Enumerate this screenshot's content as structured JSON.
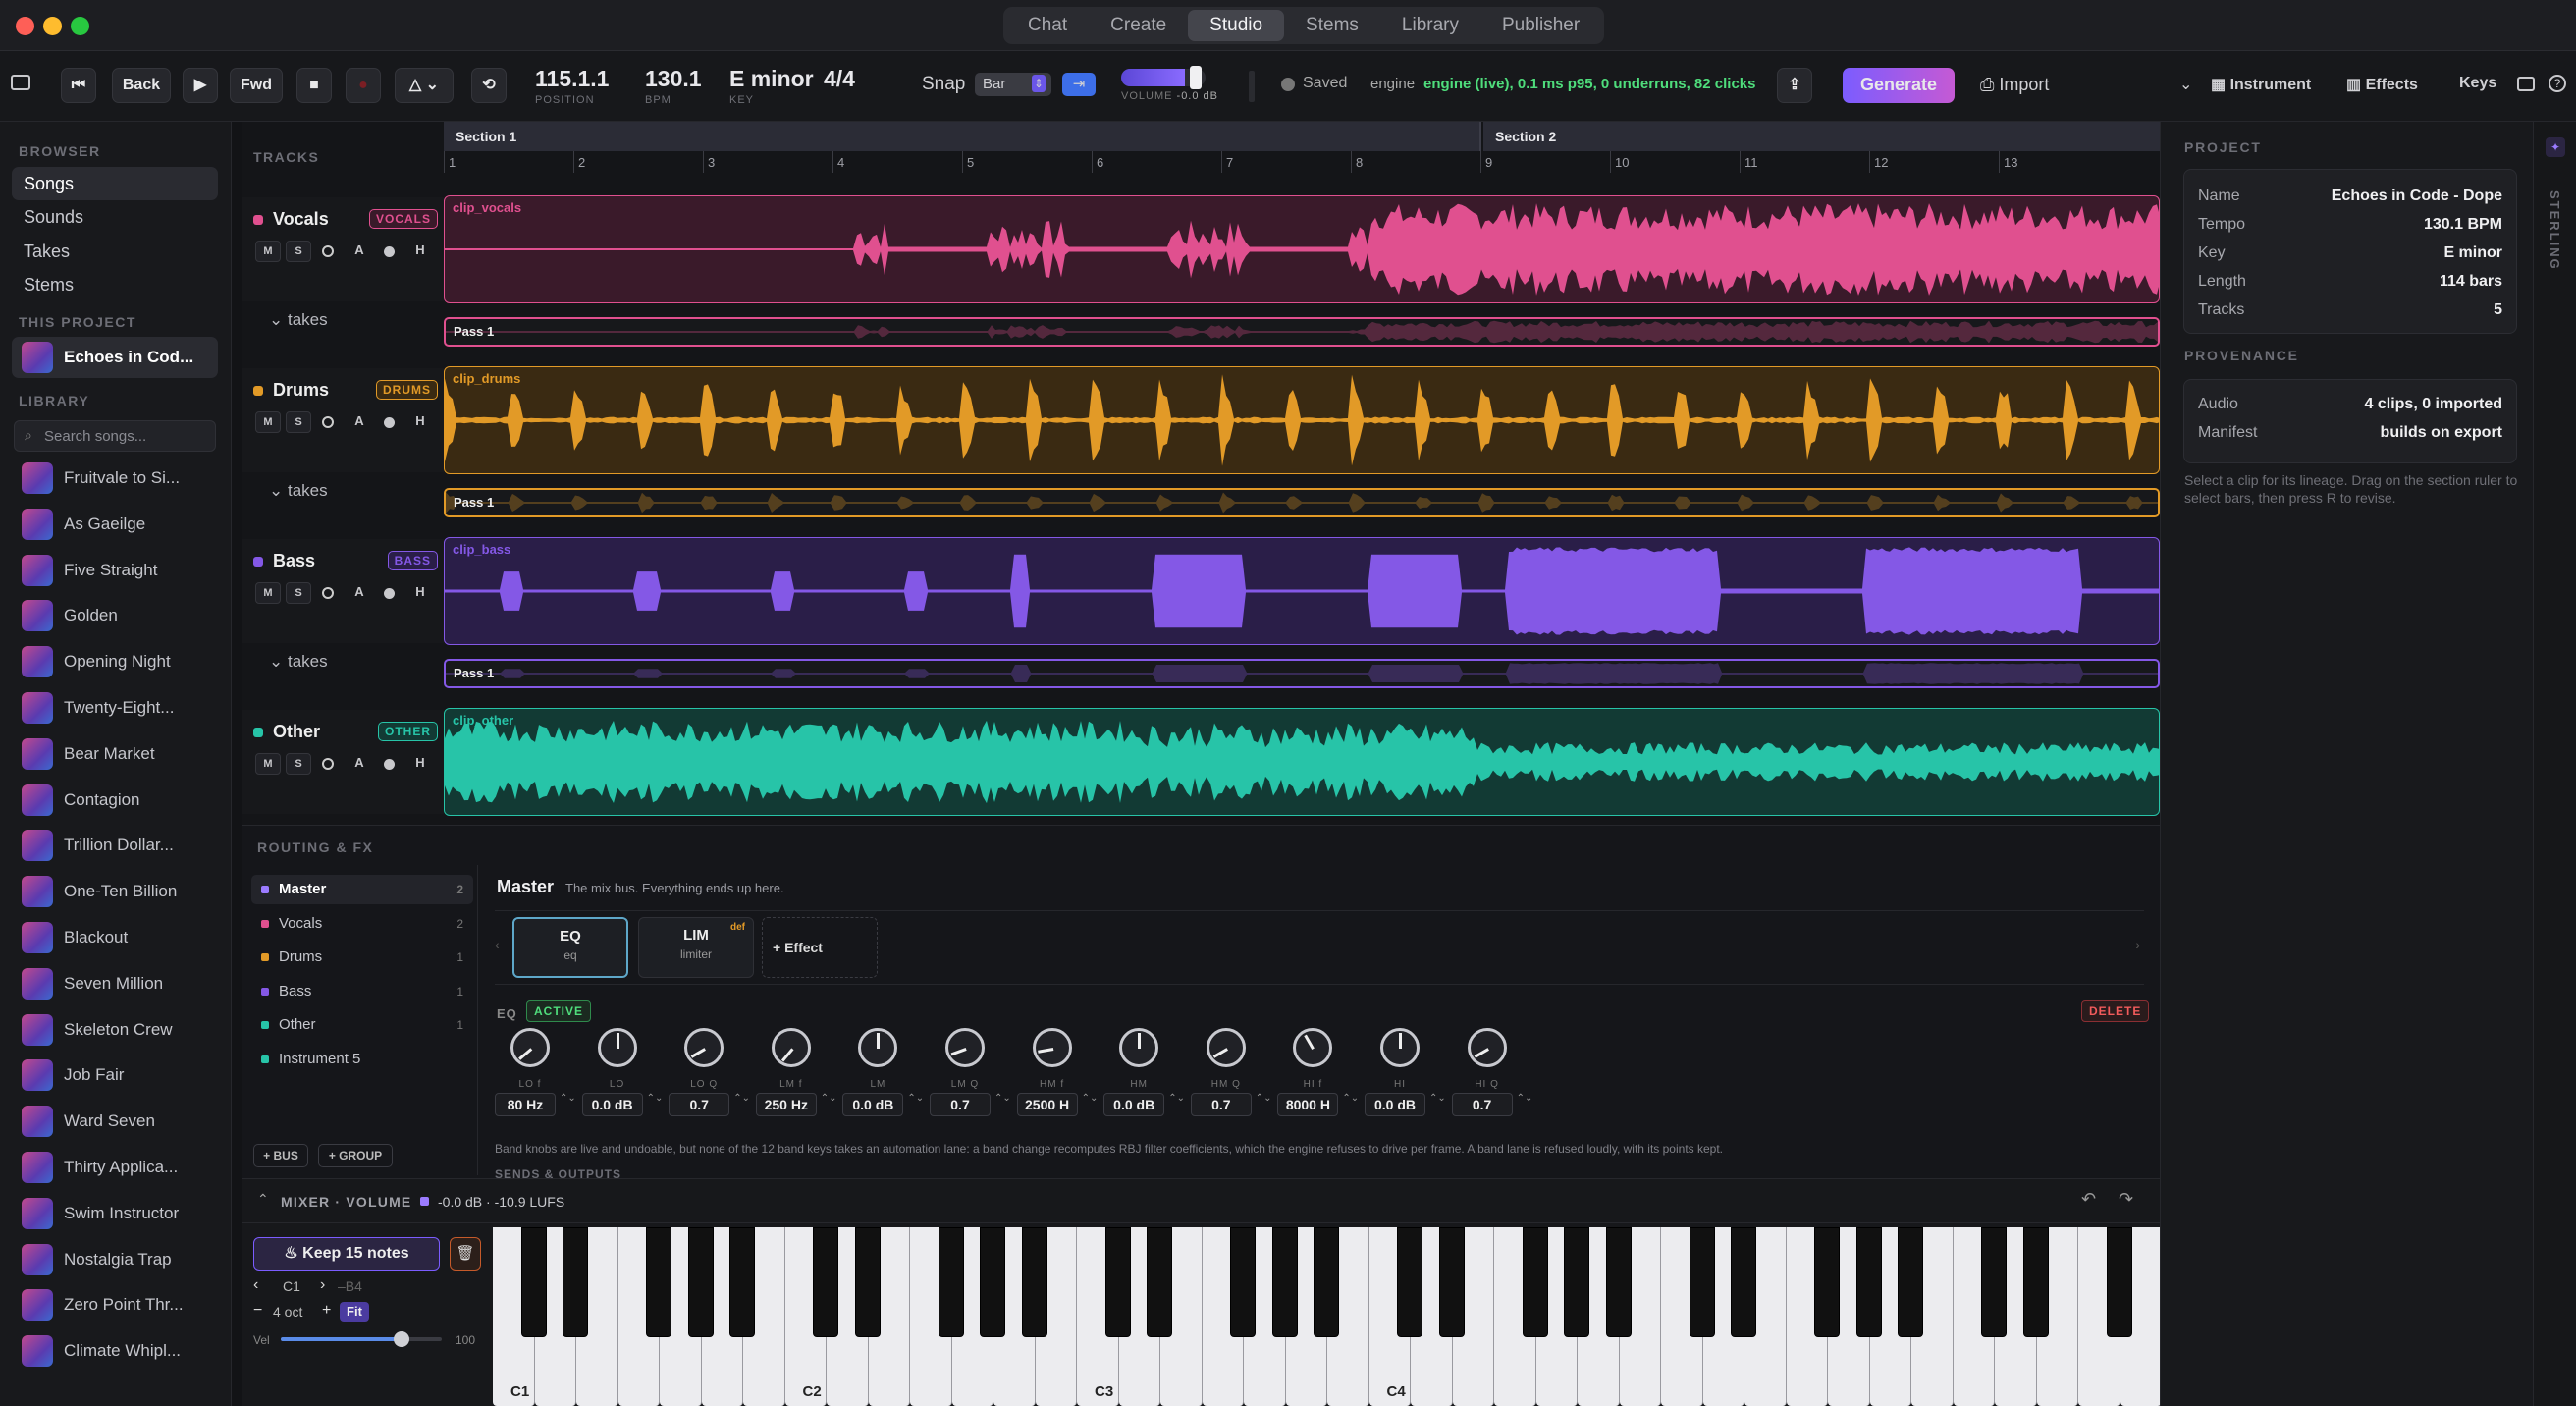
{
  "nav": {
    "tabs": [
      "Chat",
      "Create",
      "Studio",
      "Stems",
      "Library",
      "Publisher"
    ],
    "active": "Studio"
  },
  "toolbar": {
    "back": "Back",
    "fwd": "Fwd",
    "position": "115.1.1",
    "position_label": "POSITION",
    "bpm": "130.1",
    "bpm_label": "BPM",
    "key": "E minor",
    "key_label": "KEY",
    "meter": "4/4",
    "snap_label": "Snap",
    "snap_value": "Bar",
    "volume_label": "VOLUME",
    "volume_value": "-0.0 dB",
    "volume_level": 0.75,
    "saved": "Saved",
    "engine_label": "engine",
    "engine_status": "engine (live), 0.1 ms p95, 0 underruns, 82 clicks",
    "generate": "Generate",
    "import": "Import",
    "instrument": "Instrument",
    "effects": "Effects",
    "keys": "Keys"
  },
  "browser": {
    "title": "BROWSER",
    "items": [
      "Songs",
      "Sounds",
      "Takes",
      "Stems"
    ],
    "active": "Songs",
    "this_project_title": "THIS PROJECT",
    "this_project": "Echoes in Cod...",
    "library_title": "LIBRARY",
    "search_placeholder": "Search songs...",
    "songs": [
      "Fruitvale to Si...",
      "As Gaeilge",
      "Five Straight",
      "Golden",
      "Opening Night",
      "Twenty-Eight...",
      "Bear Market",
      "Contagion",
      "Trillion Dollar...",
      "One-Ten Billion",
      "Blackout",
      "Seven Million",
      "Skeleton Crew",
      "Job Fair",
      "Ward Seven",
      "Thirty Applica...",
      "Swim Instructor",
      "Nostalgia Trap",
      "Zero Point Thr...",
      "Climate Whipl..."
    ]
  },
  "tracks_panel": {
    "title": "TRACKS",
    "section1": "Section 1",
    "section2": "Section 2",
    "bars": [
      "1",
      "2",
      "3",
      "4",
      "5",
      "6",
      "7",
      "8",
      "9",
      "10",
      "11",
      "12",
      "13"
    ],
    "takes_label": "takes",
    "pass_label": "Pass 1",
    "buttons": [
      "M",
      "S",
      "A",
      "H"
    ],
    "tracks": [
      {
        "name": "Vocals",
        "tag": "VOCALS",
        "clip": "clip_vocals",
        "color": "#e0508f"
      },
      {
        "name": "Drums",
        "tag": "DRUMS",
        "clip": "clip_drums",
        "color": "#e29a27"
      },
      {
        "name": "Bass",
        "tag": "BASS",
        "clip": "clip_bass",
        "color": "#8458e6"
      },
      {
        "name": "Other",
        "tag": "OTHER",
        "clip": "clip_other",
        "color": "#27c4a8"
      }
    ]
  },
  "routing": {
    "title": "ROUTING & FX",
    "items": [
      {
        "name": "Master",
        "count": "2",
        "color": "#9b7bff"
      },
      {
        "name": "Vocals",
        "count": "2",
        "color": "#e0508f"
      },
      {
        "name": "Drums",
        "count": "1",
        "color": "#e29a27"
      },
      {
        "name": "Bass",
        "count": "1",
        "color": "#8458e6"
      },
      {
        "name": "Other",
        "count": "1",
        "color": "#27c4a8"
      },
      {
        "name": "Instrument 5",
        "count": "",
        "color": "#27c4a8"
      }
    ],
    "add_bus": "+ BUS",
    "add_group": "+ GROUP",
    "master_title": "Master",
    "master_desc": "The mix bus. Everything ends up here.",
    "fx": [
      {
        "name": "EQ",
        "sub": "eq"
      },
      {
        "name": "LIM",
        "sub": "limiter",
        "badge": "def"
      }
    ],
    "add_effect": "+ Effect",
    "eq_label": "EQ",
    "active_badge": "ACTIVE",
    "delete": "DELETE",
    "knobs": [
      {
        "l": "LO f",
        "v": "80 Hz"
      },
      {
        "l": "LO",
        "v": "0.0 dB"
      },
      {
        "l": "LO Q",
        "v": "0.7"
      },
      {
        "l": "LM f",
        "v": "250 Hz"
      },
      {
        "l": "LM",
        "v": "0.0 dB"
      },
      {
        "l": "LM Q",
        "v": "0.7"
      },
      {
        "l": "HM f",
        "v": "2500 H"
      },
      {
        "l": "HM",
        "v": "0.0 dB"
      },
      {
        "l": "HM Q",
        "v": "0.7"
      },
      {
        "l": "HI f",
        "v": "8000 H"
      },
      {
        "l": "HI",
        "v": "0.0 dB"
      },
      {
        "l": "HI Q",
        "v": "0.7"
      }
    ],
    "note": "Band knobs are live and undoable, but none of the 12 band keys takes an automation lane: a band change recomputes RBJ filter coefficients, which the engine refuses to drive per frame. A band lane is refused loudly, with its points kept.",
    "sends": "SENDS & OUTPUTS"
  },
  "mixer": {
    "label": "MIXER · VOLUME",
    "value": "-0.0 dB · -10.9 LUFS"
  },
  "keyboard": {
    "keep": "Keep 15 notes",
    "low": "C1",
    "high": "B4",
    "oct": "4 oct",
    "fit": "Fit",
    "vel_label": "Vel",
    "vel_value": "100",
    "vel_level": 0.75,
    "labels": [
      "C1",
      "C2",
      "C3",
      "C4"
    ]
  },
  "project": {
    "title": "PROJECT",
    "rows": [
      [
        "Name",
        "Echoes in Code - Dope"
      ],
      [
        "Tempo",
        "130.1 BPM"
      ],
      [
        "Key",
        "E minor"
      ],
      [
        "Length",
        "114 bars"
      ],
      [
        "Tracks",
        "5"
      ]
    ],
    "prov_title": "PROVENANCE",
    "prov": [
      [
        "Audio",
        "4 clips, 0 imported"
      ],
      [
        "Manifest",
        "builds on export"
      ]
    ],
    "hint": "Select a clip for its lineage. Drag on the section ruler to select bars, then press R to revise."
  },
  "rail": {
    "label": "STERLING"
  }
}
